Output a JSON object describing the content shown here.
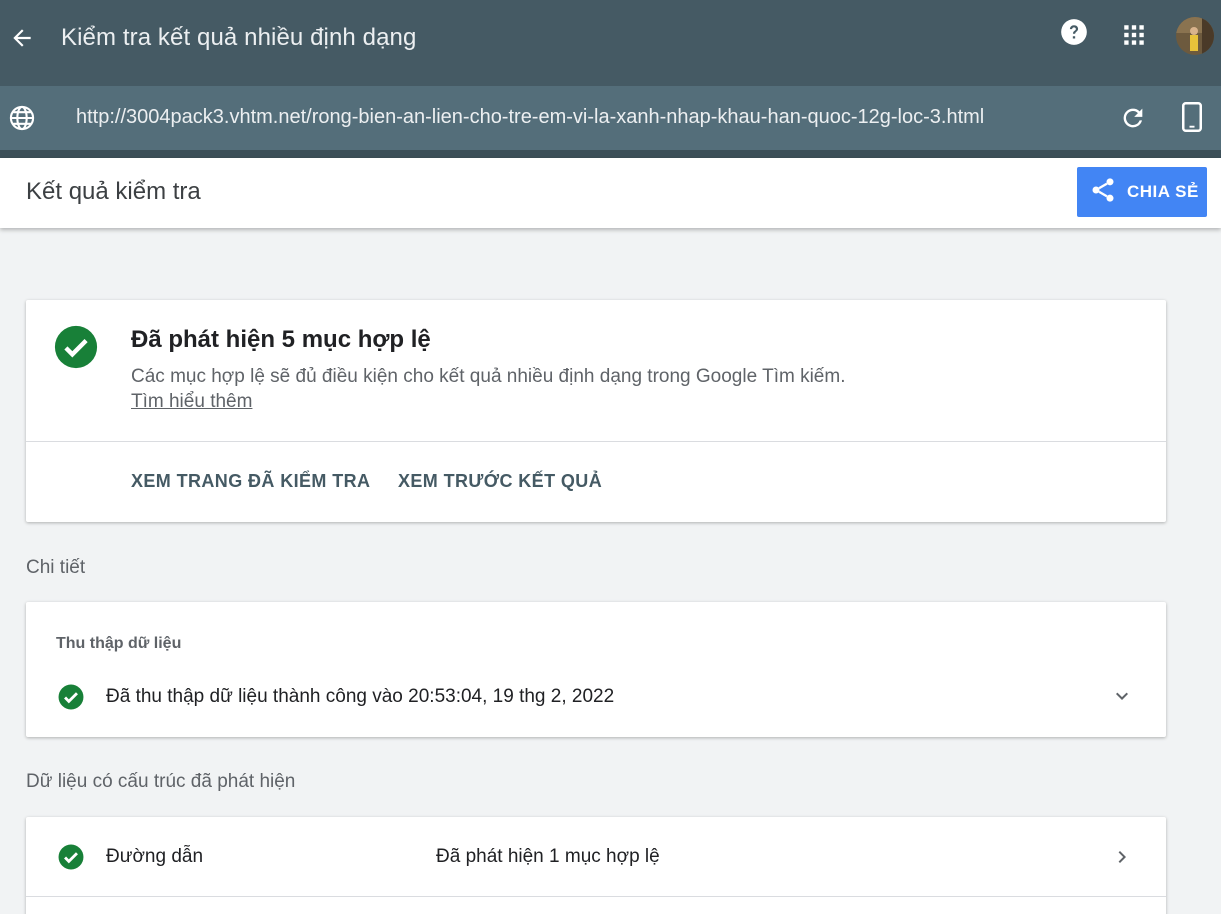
{
  "app": {
    "title": "Kiểm tra kết quả nhiều định dạng"
  },
  "url_bar": {
    "url": "http://3004pack3.vhtm.net/rong-bien-an-lien-cho-tre-em-vi-la-xanh-nhap-khau-han-quoc-12g-loc-3.html"
  },
  "header": {
    "title": "Kết quả kiểm tra",
    "share_label": "CHIA SẺ"
  },
  "summary": {
    "title": "Đã phát hiện 5 mục hợp lệ",
    "description": "Các mục hợp lệ sẽ đủ điều kiện cho kết quả nhiều định dạng trong Google Tìm kiếm.",
    "learn_more": "Tìm hiểu thêm",
    "actions": [
      "XEM TRANG ĐÃ KIỂM TRA",
      "XEM TRƯỚC KẾT QUẢ"
    ]
  },
  "details": {
    "section_label": "Chi tiết",
    "crawl_heading": "Thu thập dữ liệu",
    "crawl_status": "Đã thu thập dữ liệu thành công vào 20:53:04, 19 thg 2, 2022"
  },
  "structured": {
    "section_label": "Dữ liệu có cấu trúc đã phát hiện",
    "rows": [
      {
        "name": "Đường dẫn",
        "status": "Đã phát hiện 1 mục hợp lệ"
      }
    ]
  },
  "icons": {
    "back": "arrow-back-icon",
    "help": "help-icon",
    "apps": "apps-grid-icon",
    "globe": "globe-icon",
    "reload": "reload-icon",
    "phone": "smartphone-icon",
    "share": "share-icon",
    "valid": "check-circle-icon",
    "expand": "chevron-down-icon",
    "open": "chevron-right-icon"
  },
  "colors": {
    "topbar": "#455a64",
    "urlbar": "#546e7a",
    "share_button": "#4285f4",
    "success": "#188038"
  }
}
